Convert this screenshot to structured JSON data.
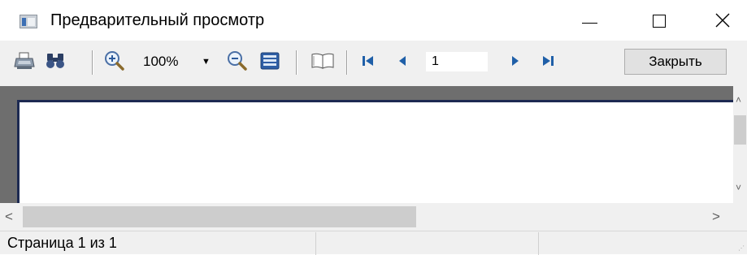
{
  "window": {
    "title": "Предварительный просмотр",
    "icon": "preview-window-icon"
  },
  "window_controls": {
    "minimize_icon": "minimize-icon",
    "maximize_icon": "maximize-icon",
    "close_icon": "close-icon"
  },
  "toolbar": {
    "zoom_value": "100%",
    "page_number": "1",
    "close_label": "Закрыть",
    "icons": [
      "print-icon",
      "find-binoculars-icon",
      "zoom-in-icon",
      "zoom-out-icon",
      "page-width-icon",
      "book-icon",
      "first-page-icon",
      "previous-page-icon",
      "next-page-icon",
      "last-page-icon"
    ],
    "accent_color": "#1f5fa8"
  },
  "preview": {
    "background_color": "#6e6e6e",
    "page_border_color": "#1d2a52"
  },
  "status": {
    "page_info": "Страница 1 из 1"
  }
}
